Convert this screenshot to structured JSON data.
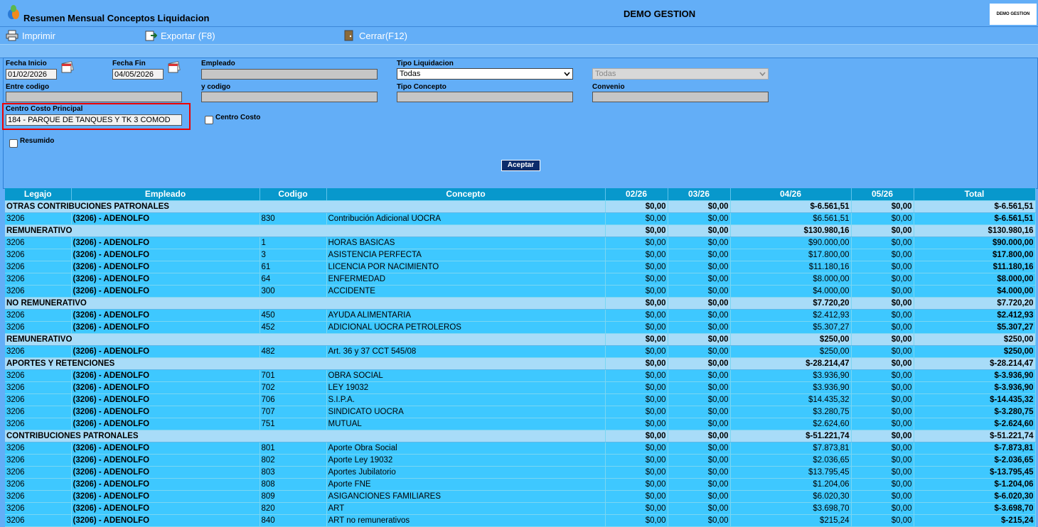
{
  "window": {
    "title": "Resumen Mensual Conceptos Liquidacion",
    "company": "DEMO GESTION",
    "brand": "DEMO GESTION"
  },
  "toolbar": {
    "print": "Imprimir",
    "export": "Exportar (F8)",
    "close": "Cerrar(F12)"
  },
  "form": {
    "fecha_inicio_label": "Fecha Inicio",
    "fecha_inicio": "01/02/2026",
    "fecha_fin_label": "Fecha Fin",
    "fecha_fin": "04/05/2026",
    "empleado_label": "Empleado",
    "empleado": "",
    "tipo_liq_label": "Tipo Liquidacion",
    "tipo_liq": "Todas",
    "tipo_liq2": "Todas",
    "entre_label": "Entre codigo",
    "entre": "",
    "y_codigo_label": "y codigo",
    "y_codigo": "",
    "tipo_concepto_label": "Tipo Concepto",
    "tipo_concepto": "",
    "convenio_label": "Convenio",
    "convenio": "",
    "cc_principal_label": "Centro Costo Principal",
    "cc_principal": "184 - PARQUE DE TANQUES Y TK 3 COMOD",
    "centro_costo_label": "Centro Costo",
    "resumido_label": "Resumido",
    "accept": "Aceptar"
  },
  "table": {
    "headers": [
      "Legajo",
      "Empleado",
      "Codigo",
      "Concepto",
      "02/26",
      "03/26",
      "04/26",
      "05/26",
      "Total"
    ],
    "rows": [
      {
        "g": true,
        "c": [
          "OTRAS CONTRIBUCIONES PATRONALES",
          "$0,00",
          "$0,00",
          "$-6.561,51",
          "$0,00",
          "$-6.561,51"
        ]
      },
      {
        "c": [
          "3206",
          "(3206) - ADENOLFO",
          "830",
          "Contribución Adicional UOCRA",
          "$0,00",
          "$0,00",
          "$6.561,51",
          "$0,00",
          "$-6.561,51"
        ]
      },
      {
        "g": true,
        "c": [
          "REMUNERATIVO",
          "$0,00",
          "$0,00",
          "$130.980,16",
          "$0,00",
          "$130.980,16"
        ]
      },
      {
        "c": [
          "3206",
          "(3206) - ADENOLFO",
          "1",
          "HORAS BASICAS",
          "$0,00",
          "$0,00",
          "$90.000,00",
          "$0,00",
          "$90.000,00"
        ]
      },
      {
        "c": [
          "3206",
          "(3206) - ADENOLFO",
          "3",
          "ASISTENCIA PERFECTA",
          "$0,00",
          "$0,00",
          "$17.800,00",
          "$0,00",
          "$17.800,00"
        ]
      },
      {
        "c": [
          "3206",
          "(3206) - ADENOLFO",
          "61",
          "LICENCIA POR NACIMIENTO",
          "$0,00",
          "$0,00",
          "$11.180,16",
          "$0,00",
          "$11.180,16"
        ]
      },
      {
        "c": [
          "3206",
          "(3206) - ADENOLFO",
          "64",
          "ENFERMEDAD",
          "$0,00",
          "$0,00",
          "$8.000,00",
          "$0,00",
          "$8.000,00"
        ]
      },
      {
        "c": [
          "3206",
          "(3206) - ADENOLFO",
          "300",
          "ACCIDENTE",
          "$0,00",
          "$0,00",
          "$4.000,00",
          "$0,00",
          "$4.000,00"
        ]
      },
      {
        "g": true,
        "c": [
          "NO REMUNERATIVO",
          "$0,00",
          "$0,00",
          "$7.720,20",
          "$0,00",
          "$7.720,20"
        ]
      },
      {
        "c": [
          "3206",
          "(3206) - ADENOLFO",
          "450",
          "AYUDA ALIMENTARIA",
          "$0,00",
          "$0,00",
          "$2.412,93",
          "$0,00",
          "$2.412,93"
        ]
      },
      {
        "c": [
          "3206",
          "(3206) - ADENOLFO",
          "452",
          "ADICIONAL UOCRA PETROLEROS",
          "$0,00",
          "$0,00",
          "$5.307,27",
          "$0,00",
          "$5.307,27"
        ]
      },
      {
        "g": true,
        "c": [
          "REMUNERATIVO",
          "$0,00",
          "$0,00",
          "$250,00",
          "$0,00",
          "$250,00"
        ]
      },
      {
        "c": [
          "3206",
          "(3206) - ADENOLFO",
          "482",
          "Art. 36 y 37 CCT 545/08",
          "$0,00",
          "$0,00",
          "$250,00",
          "$0,00",
          "$250,00"
        ]
      },
      {
        "g": true,
        "c": [
          "APORTES Y RETENCIONES",
          "$0,00",
          "$0,00",
          "$-28.214,47",
          "$0,00",
          "$-28.214,47"
        ]
      },
      {
        "c": [
          "3206",
          "(3206) - ADENOLFO",
          "701",
          "OBRA SOCIAL",
          "$0,00",
          "$0,00",
          "$3.936,90",
          "$0,00",
          "$-3.936,90"
        ]
      },
      {
        "c": [
          "3206",
          "(3206) - ADENOLFO",
          "702",
          "LEY 19032",
          "$0,00",
          "$0,00",
          "$3.936,90",
          "$0,00",
          "$-3.936,90"
        ]
      },
      {
        "c": [
          "3206",
          "(3206) - ADENOLFO",
          "706",
          "S.I.P.A.",
          "$0,00",
          "$0,00",
          "$14.435,32",
          "$0,00",
          "$-14.435,32"
        ]
      },
      {
        "c": [
          "3206",
          "(3206) - ADENOLFO",
          "707",
          "SINDICATO UOCRA",
          "$0,00",
          "$0,00",
          "$3.280,75",
          "$0,00",
          "$-3.280,75"
        ]
      },
      {
        "c": [
          "3206",
          "(3206) - ADENOLFO",
          "751",
          "MUTUAL",
          "$0,00",
          "$0,00",
          "$2.624,60",
          "$0,00",
          "$-2.624,60"
        ]
      },
      {
        "g": true,
        "c": [
          "CONTRIBUCIONES PATRONALES",
          "$0,00",
          "$0,00",
          "$-51.221,74",
          "$0,00",
          "$-51.221,74"
        ]
      },
      {
        "c": [
          "3206",
          "(3206) - ADENOLFO",
          "801",
          "Aporte Obra Social",
          "$0,00",
          "$0,00",
          "$7.873,81",
          "$0,00",
          "$-7.873,81"
        ]
      },
      {
        "c": [
          "3206",
          "(3206) - ADENOLFO",
          "802",
          "Aporte Ley 19032",
          "$0,00",
          "$0,00",
          "$2.036,65",
          "$0,00",
          "$-2.036,65"
        ]
      },
      {
        "c": [
          "3206",
          "(3206) - ADENOLFO",
          "803",
          "Aportes Jubilatorio",
          "$0,00",
          "$0,00",
          "$13.795,45",
          "$0,00",
          "$-13.795,45"
        ]
      },
      {
        "c": [
          "3206",
          "(3206) - ADENOLFO",
          "808",
          "Aporte FNE",
          "$0,00",
          "$0,00",
          "$1.204,06",
          "$0,00",
          "$-1.204,06"
        ]
      },
      {
        "c": [
          "3206",
          "(3206) - ADENOLFO",
          "809",
          "ASIGANCIONES FAMILIARES",
          "$0,00",
          "$0,00",
          "$6.020,30",
          "$0,00",
          "$-6.020,30"
        ]
      },
      {
        "c": [
          "3206",
          "(3206) - ADENOLFO",
          "820",
          "ART",
          "$0,00",
          "$0,00",
          "$3.698,70",
          "$0,00",
          "$-3.698,70"
        ]
      },
      {
        "c": [
          "3206",
          "(3206) - ADENOLFO",
          "840",
          "ART no remunerativos",
          "$0,00",
          "$0,00",
          "$215,24",
          "$0,00",
          "$-215,24"
        ]
      }
    ]
  }
}
